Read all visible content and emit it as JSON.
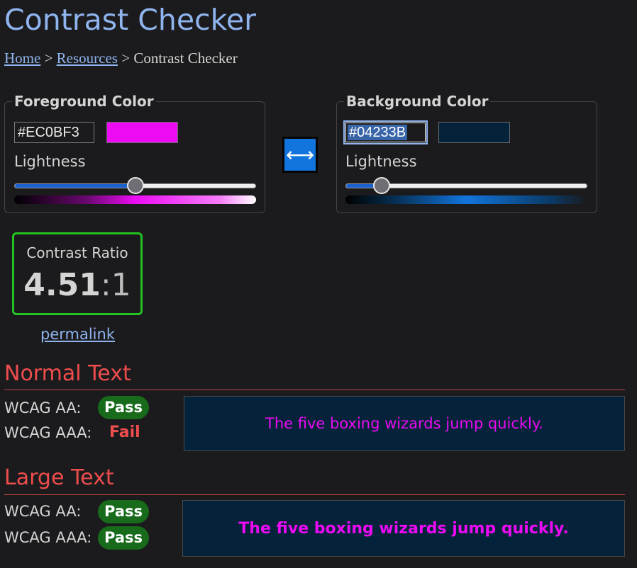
{
  "page": {
    "title": "Contrast Checker"
  },
  "breadcrumb": {
    "home": "Home",
    "sep1": ">",
    "resources": "Resources",
    "sep2": ">",
    "current": "Contrast Checker"
  },
  "foreground": {
    "legend": "Foreground Color",
    "hex_value": "#EC0BF3",
    "color": "#EC0BF3",
    "lightness_label": "Lightness",
    "lightness_fraction": 0.5
  },
  "background": {
    "legend": "Background Color",
    "hex_value": "#04233B",
    "color": "#04233B",
    "lightness_label": "Lightness",
    "lightness_fraction": 0.15
  },
  "swap": {
    "icon": "swap-arrows-icon",
    "glyph": "⟷"
  },
  "ratio": {
    "label": "Contrast Ratio",
    "value": "4.51",
    "suffix": ":1",
    "border_color": "#22C322"
  },
  "permalink": "permalink",
  "normal_text": {
    "heading": "Normal Text",
    "rows": [
      {
        "label": "WCAG AA:",
        "result": "Pass"
      },
      {
        "label": "WCAG AAA:",
        "result": "Fail"
      }
    ],
    "sample": "The five boxing wizards jump quickly."
  },
  "large_text": {
    "heading": "Large Text",
    "rows": [
      {
        "label": "WCAG AA:",
        "result": "Pass"
      },
      {
        "label": "WCAG AAA:",
        "result": "Pass"
      }
    ],
    "sample": "The five boxing wizards jump quickly."
  },
  "colors": {
    "pass": "#176B1A",
    "fail": "#EF4D4D",
    "heading": "#EF4D4D",
    "link": "#8FB4EE"
  }
}
